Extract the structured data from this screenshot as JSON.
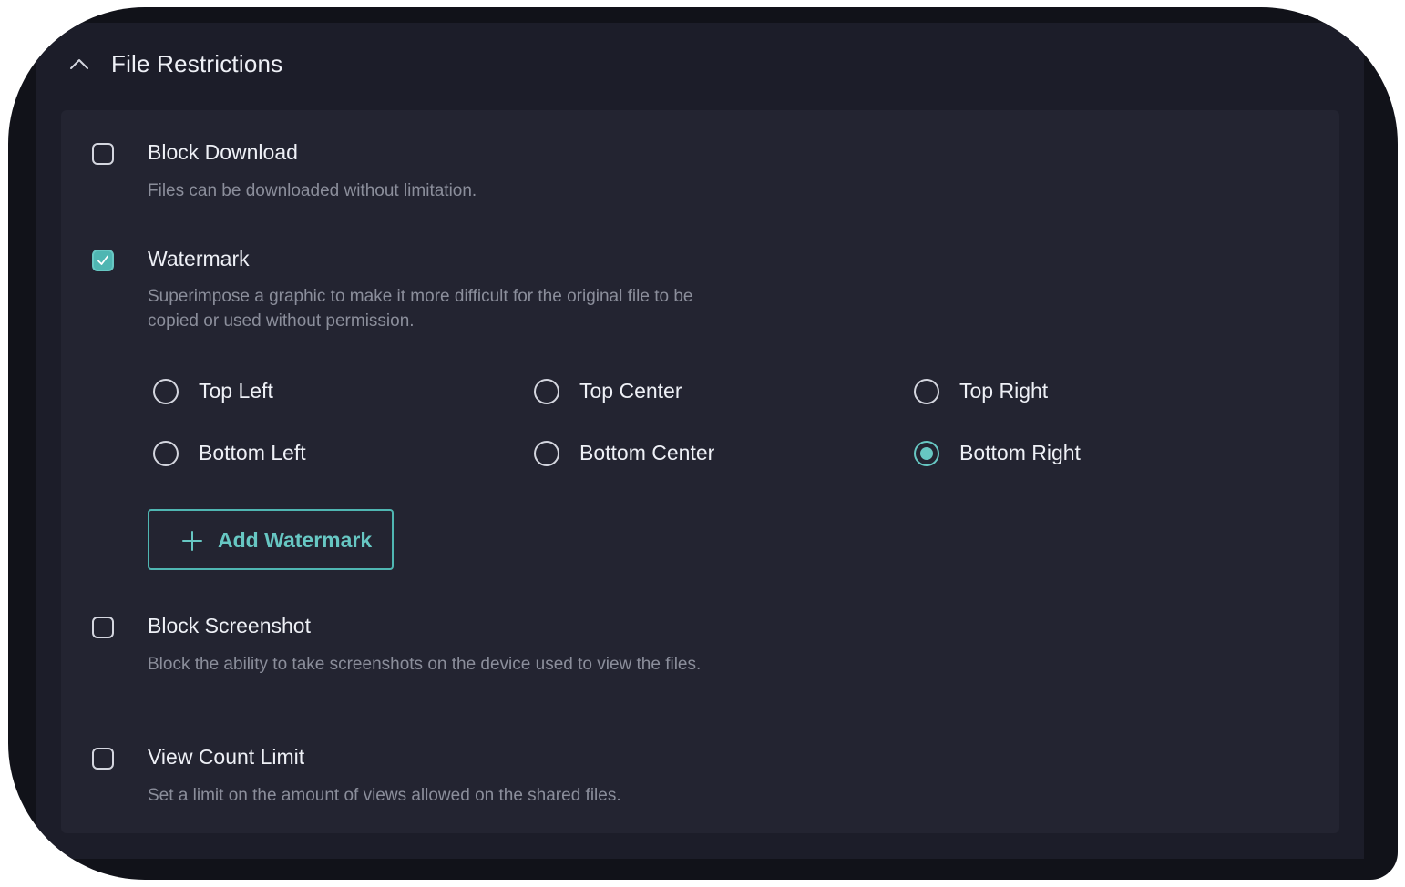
{
  "section": {
    "title": "File Restrictions",
    "expanded": true,
    "chevron_icon": "chevron-up-icon"
  },
  "options": {
    "block_download": {
      "title": "Block Download",
      "description": "Files can be downloaded without limitation.",
      "checked": false
    },
    "watermark": {
      "title": "Watermark",
      "description": "Superimpose a graphic to make it more difficult  for the original file to be copied or used without permission.",
      "checked": true,
      "positions": {
        "top_left": "Top Left",
        "top_center": "Top Center",
        "top_right": "Top Right",
        "bottom_left": "Bottom Left",
        "bottom_center": "Bottom Center",
        "bottom_right": "Bottom Right"
      },
      "selected_position": "Bottom Right",
      "add_button_label": "Add Watermark",
      "add_button_icon": "plus-icon"
    },
    "block_screenshot": {
      "title": "Block Screenshot",
      "description": "Block the ability to take screenshots on the device used to view the files.",
      "checked": false
    },
    "view_count_limit": {
      "title": "View Count Limit",
      "description": "Set a limit on the amount of views allowed on the shared files.",
      "checked": false
    }
  },
  "colors": {
    "accent": "#4fb6b2",
    "accent_light": "#67c7c3",
    "panel_bg": "#1c1d29",
    "inner_bg": "#232431",
    "frame_bg": "#111219",
    "text_primary": "#eef0f6",
    "text_secondary": "#8b8e9b"
  }
}
